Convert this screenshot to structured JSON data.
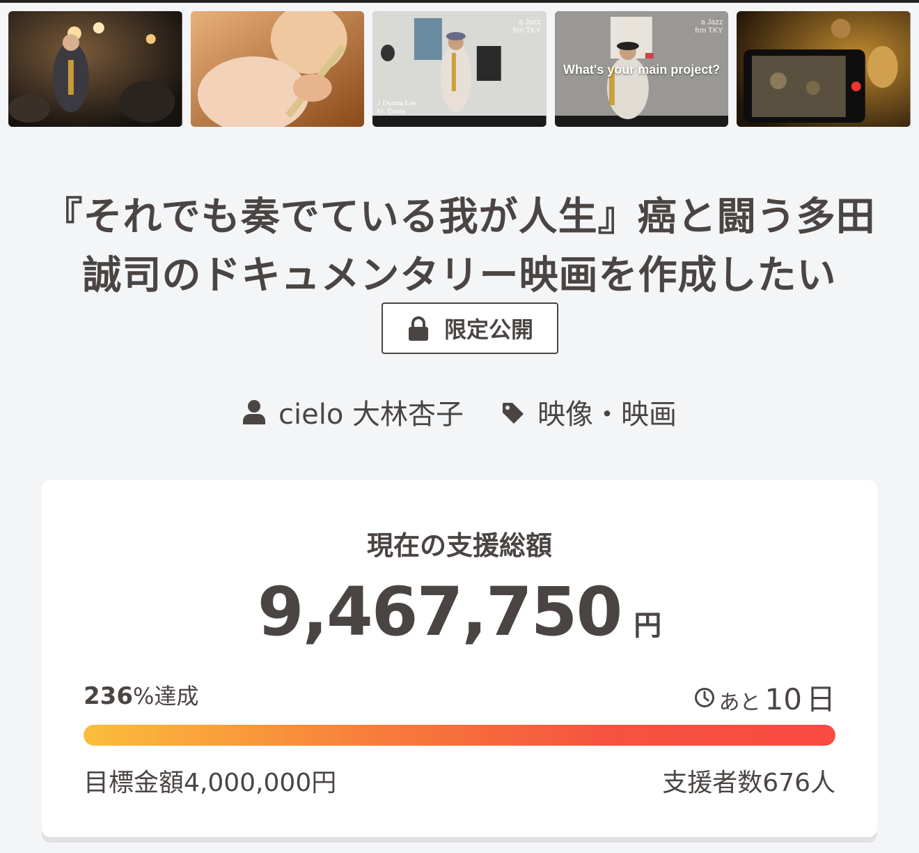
{
  "gallery": {
    "thumb3_tag": "a Jazz\nfrm TKY",
    "thumb3_credit": "♪ Donna Lee\nM. Davis",
    "thumb4_tag": "a Jazz\nfrm TKY",
    "thumb4_question": "What's your main project?"
  },
  "project": {
    "title": "『それでも奏でている我が人生』癌と闘う多田誠司のドキュメンタリー映画を作成したい",
    "visibility_badge": "限定公開",
    "owner": "cielo 大林杏子",
    "category": "映像・映画"
  },
  "funding": {
    "label": "現在の支援総額",
    "amount": "9,467,750",
    "currency": "円",
    "percent_value": "236",
    "percent_suffix": "%達成",
    "remaining_prefix": "あと",
    "remaining_days": "10",
    "remaining_unit": "日",
    "progress_fraction": 1.0,
    "goal_text": "目標金額4,000,000円",
    "backers_text": "支援者数676人"
  },
  "colors": {
    "text": "#4a4543",
    "background": "#f4f5f7",
    "progress_start": "#fbbd3b",
    "progress_end": "#fc4a44"
  },
  "icons": {
    "lock": "lock-icon",
    "user": "user-icon",
    "tag": "tag-icon",
    "clock": "clock-icon"
  }
}
